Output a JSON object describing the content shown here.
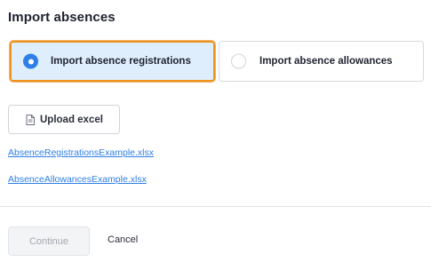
{
  "dialog": {
    "title": "Import absences"
  },
  "import_type": {
    "options": [
      {
        "label": "Import absence registrations",
        "selected": true
      },
      {
        "label": "Import absence allowances",
        "selected": false
      }
    ]
  },
  "upload": {
    "label": "Upload excel",
    "icon": "file-icon"
  },
  "links": {
    "registrations_example": "AbsenceRegistrationsExample.xlsx",
    "allowances_example": "AbsenceAllowancesExample.xlsx"
  },
  "footer": {
    "continue_label": "Continue",
    "cancel_label": "Cancel"
  },
  "colors": {
    "accent": "#2f7fe6",
    "focus_outline": "#ec931f",
    "selected_bg": "#deeefc"
  }
}
